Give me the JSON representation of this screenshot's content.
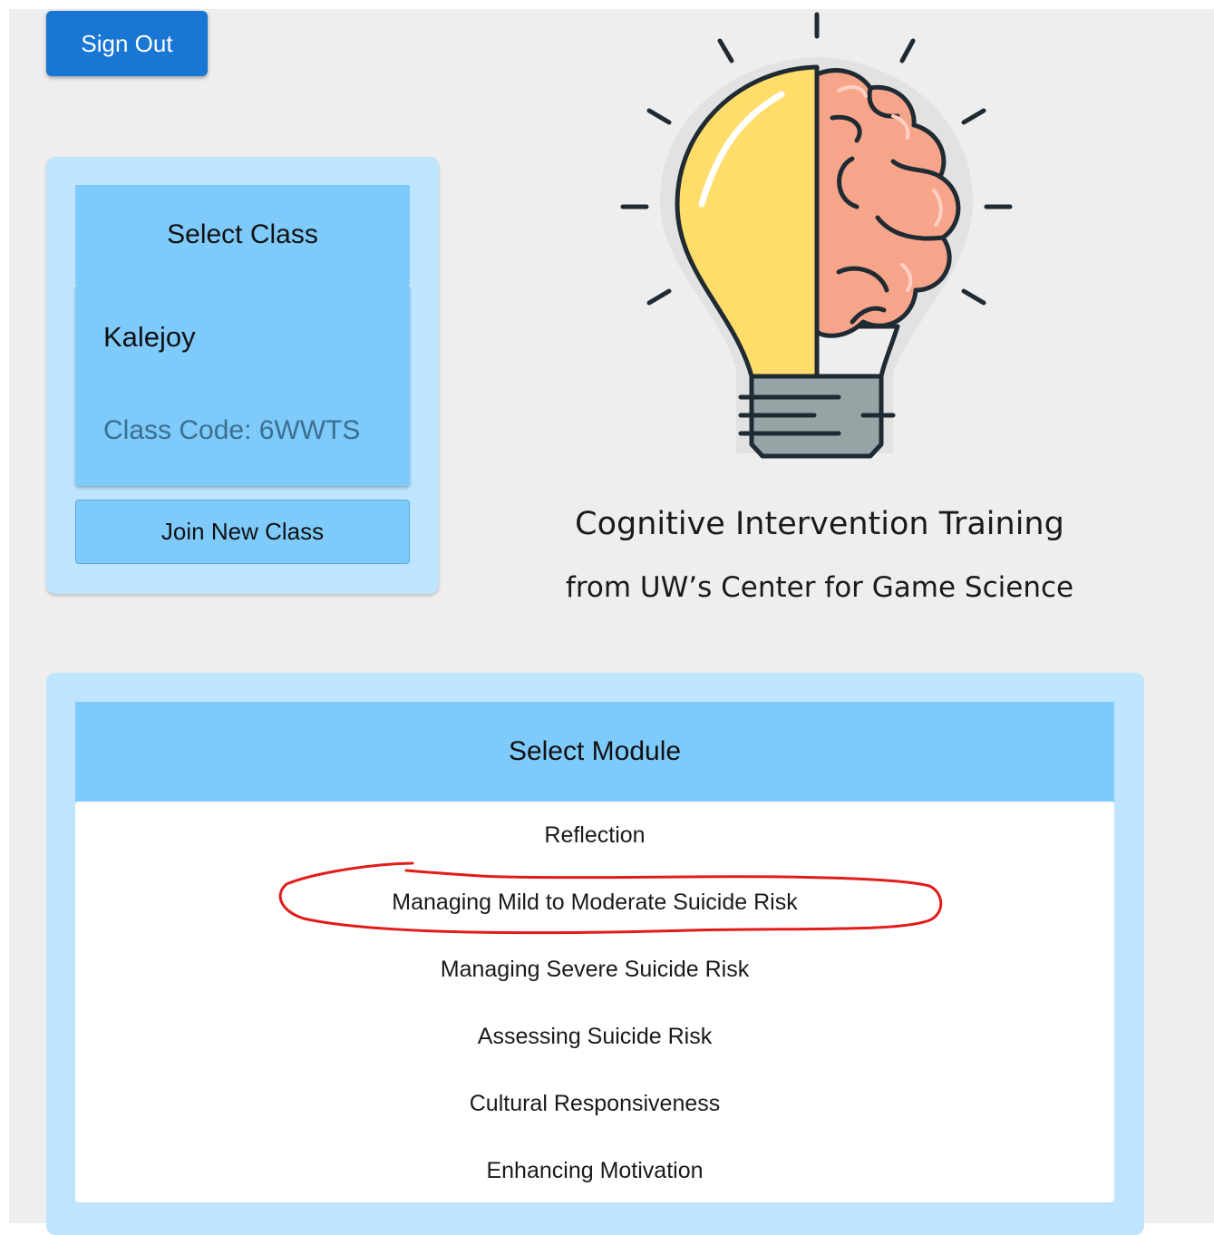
{
  "header": {
    "sign_out_label": "Sign Out"
  },
  "class_panel": {
    "title": "Select Class",
    "classes": [
      {
        "name": "Kalejoy",
        "code_label": "Class Code:",
        "code": "6WWTS"
      }
    ],
    "join_label": "Join New Class"
  },
  "branding": {
    "title": "Cognitive Intervention Training",
    "subtitle": "from UW’s Center for Game Science",
    "logo_icon": "lightbulb-brain-icon"
  },
  "module_panel": {
    "title": "Select Module",
    "modules": [
      "Reflection",
      "Managing Mild to Moderate Suicide Risk",
      "Managing Severe Suicide Risk",
      "Assessing Suicide Risk",
      "Cultural Responsiveness",
      "Enhancing Motivation"
    ],
    "annotated_module": "Managing Mild to Moderate Suicide Risk"
  },
  "colors": {
    "primary_button": "#1976d2",
    "panel_background": "#bfe4fd",
    "panel_header": "#7ecafb",
    "page_background": "#eeeeee",
    "annotation": "#e21b1b",
    "bulb_yellow": "#ffdd6b",
    "brain_pink": "#f7a58a",
    "bulb_base": "#95a5a6"
  }
}
